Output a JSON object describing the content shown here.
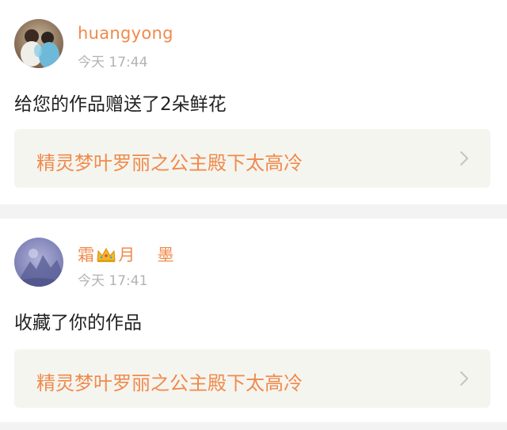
{
  "notifications": [
    {
      "username": "huangyong",
      "time": "今天 17:44",
      "action": "给您的作品赠送了2朵鲜花",
      "work_title": "精灵梦叶罗丽之公主殿下太高冷",
      "avatar_icon": "profile-photo",
      "chevron_icon": "chevron-right-icon"
    },
    {
      "username_part1": "霜",
      "username_part2": "月    墨",
      "crown_icon": "crown-emoji-icon",
      "time": "今天 17:41",
      "action": "收藏了你的作品",
      "work_title": "精灵梦叶罗丽之公主殿下太高冷",
      "avatar_icon": "profile-photo",
      "chevron_icon": "chevron-right-icon"
    }
  ],
  "colors": {
    "accent": "#f08a4b",
    "time": "#b3b3b3",
    "body_text": "#222222",
    "link_bg": "#f5f5f0",
    "separator": "#f3f3f3"
  }
}
